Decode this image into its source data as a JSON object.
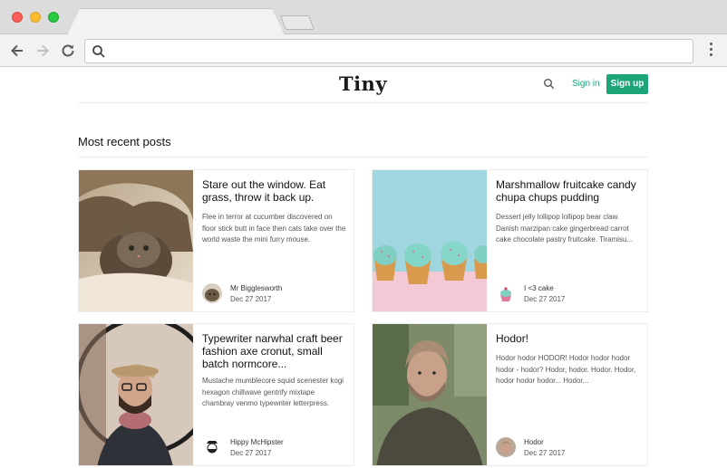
{
  "site": {
    "logo": "Tiny",
    "sign_in": "Sign in",
    "sign_up": "Sign up"
  },
  "section_title": "Most recent posts",
  "posts": [
    {
      "title": "Stare out the window. Eat grass, throw it back up.",
      "excerpt": "Flee in terror at cucumber discovered on floor stick butt in face then cats take over the world waste the mini furry mouse.",
      "author": "Mr Bigglesworth",
      "date": "Dec 27 2017"
    },
    {
      "title": "Marshmallow fruitcake candy chupa chups pudding",
      "excerpt": "Dessert jelly lollipop lollipop bear claw. Danish marzipan cake gingerbread carrot cake chocolate pastry fruitcake. Tiramisu...",
      "author": "I <3 cake",
      "date": "Dec 27 2017"
    },
    {
      "title": "Typewriter narwhal craft beer fashion axe cronut, small batch normcore...",
      "excerpt": "Mustache mumblecore squid scenester kogi hexagon chillwave gentrify mixtape chambray venmo typewriter letterpress.",
      "author": "Hippy McHipster",
      "date": "Dec 27 2017"
    },
    {
      "title": "Hodor!",
      "excerpt": "Hodor hodor HODOR! Hodor hodor hodor hodor - hodor? Hodor, hodor. Hodor. Hodor, hodor hodor hodor... Hodor...",
      "author": "Hodor",
      "date": "Dec 27 2017"
    }
  ],
  "colors": {
    "accent": "#1da57a"
  }
}
